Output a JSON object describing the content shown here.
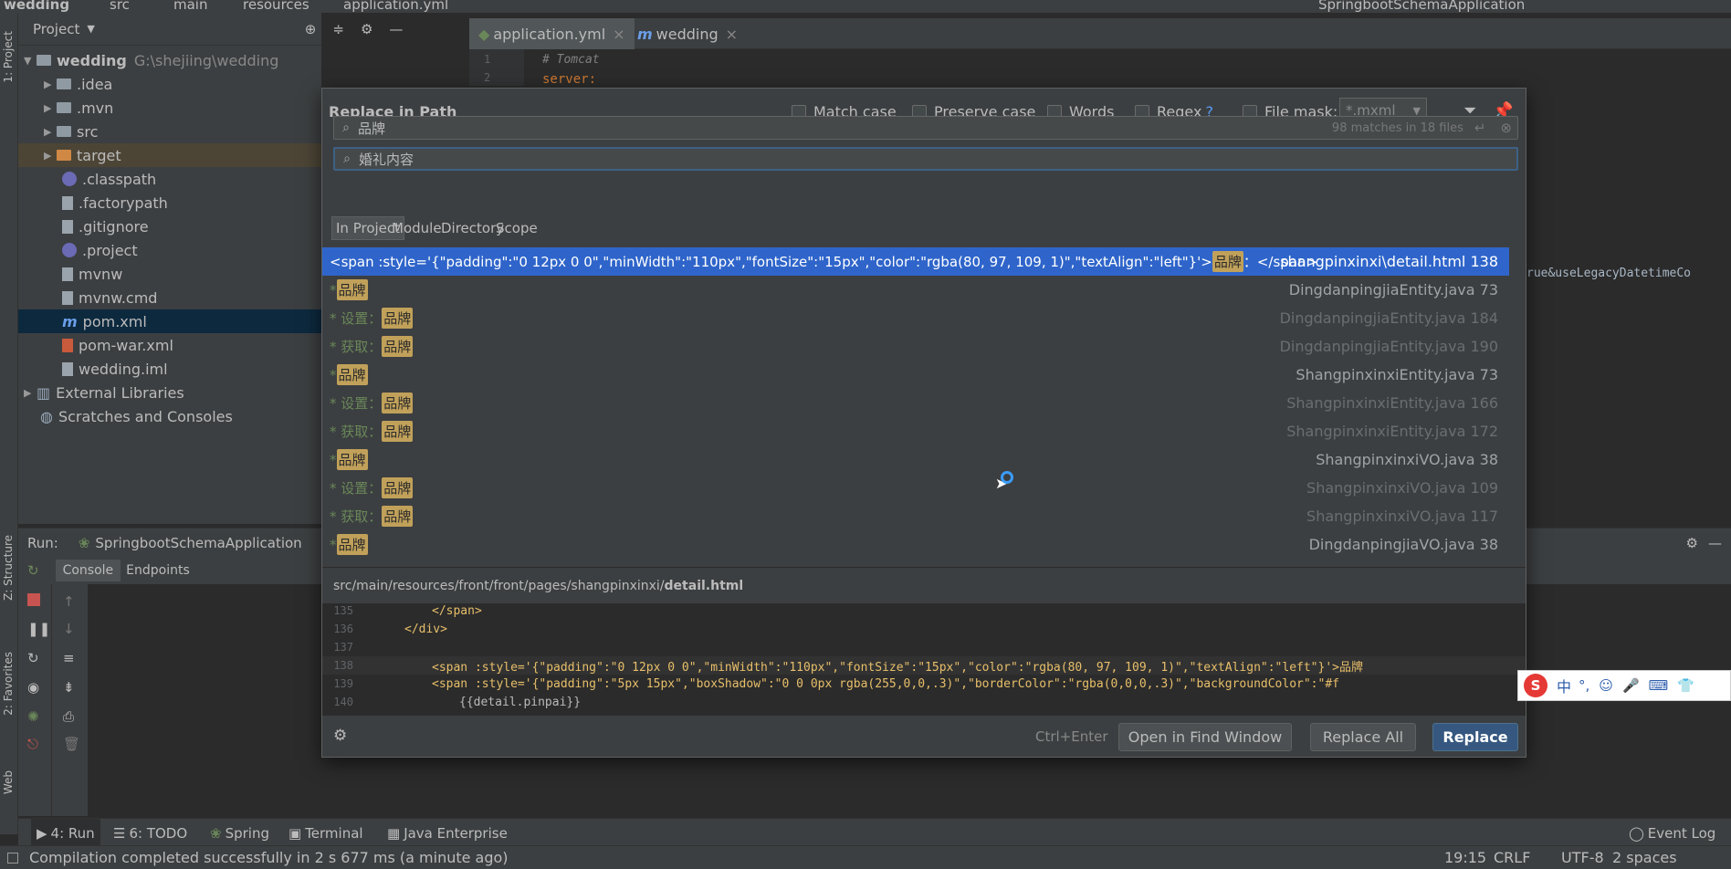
{
  "nav": {
    "crumbs": [
      "wedding",
      "src",
      "main",
      "resources",
      "application.yml"
    ],
    "run_config": "SpringbootSchemaApplication"
  },
  "left_stripe": {
    "project": "1: Project",
    "structure": "Z: Structure",
    "favorites": "2: Favorites",
    "web": "Web"
  },
  "project": {
    "header": "Project",
    "items": [
      {
        "label": "wedding",
        "extra": "G:\\shejiing\\wedding"
      },
      {
        "label": ".idea"
      },
      {
        "label": ".mvn"
      },
      {
        "label": "src"
      },
      {
        "label": "target"
      },
      {
        "label": ".classpath"
      },
      {
        "label": ".factorypath"
      },
      {
        "label": ".gitignore"
      },
      {
        "label": ".project"
      },
      {
        "label": "mvnw"
      },
      {
        "label": "mvnw.cmd"
      },
      {
        "label": "pom.xml"
      },
      {
        "label": "pom-war.xml"
      },
      {
        "label": "wedding.iml"
      },
      {
        "label": "External Libraries"
      },
      {
        "label": "Scratches and Consoles"
      }
    ]
  },
  "editor": {
    "tabs": [
      "application.yml",
      "wedding"
    ],
    "lines": [
      "1",
      "2"
    ],
    "code": [
      "# Tomcat",
      "server:"
    ],
    "right_snippet": "rue&useLegacyDatetimeCo"
  },
  "run": {
    "label": "Run:",
    "config": "SpringbootSchemaApplication",
    "tabs": [
      "Console",
      "Endpoints"
    ]
  },
  "dialog": {
    "title": "Replace in Path",
    "options": [
      "Match case",
      "Preserve case",
      "Words",
      "Regex",
      "File mask:"
    ],
    "regex_help": "?",
    "file_mask": "*.mxml",
    "search": "品牌",
    "match_count": "98 matches in 18 files",
    "replace": "婚礼内容",
    "scopes": [
      "In Project",
      "Module",
      "Directory",
      "Scope"
    ],
    "results": [
      {
        "prefix": "<span :style='{\"padding\":\"0 12px 0 0\",\"minWidth\":\"110px\",\"fontSize\":\"15px\",\"color\":\"rgba(80, 97, 109, 1)\",\"textAlign\":\"left\"}'>",
        "hl": "品牌",
        "suffix": "：</span>",
        "loc": "shangpinxinxi\\detail.html 138"
      },
      {
        "prefix": "* ",
        "hl": "品牌",
        "suffix": "",
        "loc": "DingdanpingjiaEntity.java 73"
      },
      {
        "prefix": "* 设置：",
        "hl": "品牌",
        "suffix": "",
        "loc": "DingdanpingjiaEntity.java 184"
      },
      {
        "prefix": "* 获取：",
        "hl": "品牌",
        "suffix": "",
        "loc": "DingdanpingjiaEntity.java 190"
      },
      {
        "prefix": "* ",
        "hl": "品牌",
        "suffix": "",
        "loc": "ShangpinxinxiEntity.java 73"
      },
      {
        "prefix": "* 设置：",
        "hl": "品牌",
        "suffix": "",
        "loc": "ShangpinxinxiEntity.java 166"
      },
      {
        "prefix": "* 获取：",
        "hl": "品牌",
        "suffix": "",
        "loc": "ShangpinxinxiEntity.java 172"
      },
      {
        "prefix": "* ",
        "hl": "品牌",
        "suffix": "",
        "loc": "ShangpinxinxiVO.java 38"
      },
      {
        "prefix": "* 设置：",
        "hl": "品牌",
        "suffix": "",
        "loc": "ShangpinxinxiVO.java 109"
      },
      {
        "prefix": "* 获取：",
        "hl": "品牌",
        "suffix": "",
        "loc": "ShangpinxinxiVO.java 117"
      },
      {
        "prefix": "* ",
        "hl": "品牌",
        "suffix": "",
        "loc": "DingdanpingjiaVO.java 38"
      }
    ],
    "path": "src/main/resources/front/front/pages/shangpinxinxi/",
    "path_file": "detail.html",
    "preview": [
      {
        "n": "135",
        "code": "</span>"
      },
      {
        "n": "136",
        "code": "</div>"
      },
      {
        "n": "137",
        "code": ""
      },
      {
        "n": "138",
        "code": "<span :style='{\"padding\":\"0 12px 0 0\",\"minWidth\":\"110px\",\"fontSize\":\"15px\",\"color\":\"rgba(80, 97, 109, 1)\",\"textAlign\":\"left\"}'>品牌"
      },
      {
        "n": "139",
        "code": "<span :style='{\"padding\":\"5px 15px\",\"boxShadow\":\"0 0 0px rgba(255,0,0,.3)\",\"borderColor\":\"rgba(0,0,0,.3)\",\"backgroundColor\":\"#f"
      },
      {
        "n": "140",
        "code": "{{detail.pinpai}}"
      }
    ],
    "shortcut": "Ctrl+Enter",
    "buttons": [
      "Open in Find Window",
      "Replace All",
      "Replace"
    ]
  },
  "bottom_tabs": [
    "4: Run",
    "6: TODO",
    "Spring",
    "Terminal",
    "Java Enterprise",
    "Event Log"
  ],
  "status": {
    "message": "Compilation completed successfully in 2 s 677 ms (a minute ago)",
    "position": "19:15",
    "line_sep": "CRLF",
    "encoding": "UTF-8",
    "indent": "2 spaces"
  },
  "ime": {
    "label": "中"
  },
  "colors": {
    "accent": "#2f65ca",
    "highlight": "#c1a15a",
    "primary_button": "#365880"
  }
}
